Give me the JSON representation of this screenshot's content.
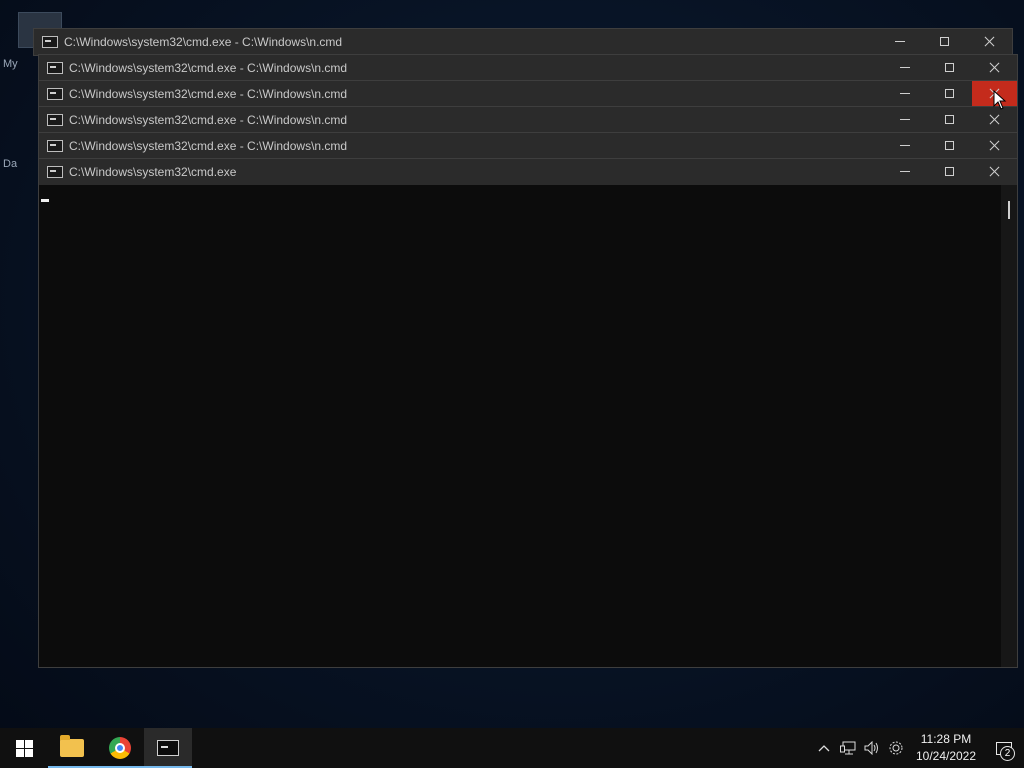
{
  "desktop": {
    "icon_labels": [
      "My",
      "Da"
    ]
  },
  "windows": [
    {
      "title": "C:\\Windows\\system32\\cmd.exe - C:\\Windows\\n.cmd"
    },
    {
      "title": "C:\\Windows\\system32\\cmd.exe - C:\\Windows\\n.cmd"
    },
    {
      "title": "C:\\Windows\\system32\\cmd.exe - C:\\Windows\\n.cmd"
    },
    {
      "title": "C:\\Windows\\system32\\cmd.exe - C:\\Windows\\n.cmd"
    },
    {
      "title": "C:\\Windows\\system32\\cmd.exe - C:\\Windows\\n.cmd"
    },
    {
      "title": "C:\\Windows\\system32\\cmd.exe"
    }
  ],
  "taskbar": {
    "pinned": [
      "start-icon",
      "file-explorer-icon",
      "chrome-icon",
      "command-prompt-icon"
    ],
    "tray": {
      "time": "11:28 PM",
      "date": "10/24/2022",
      "notification_count": "2"
    }
  },
  "colors": {
    "close_hover": "#c42b1c",
    "taskbar_accent": "#76b9ed"
  }
}
